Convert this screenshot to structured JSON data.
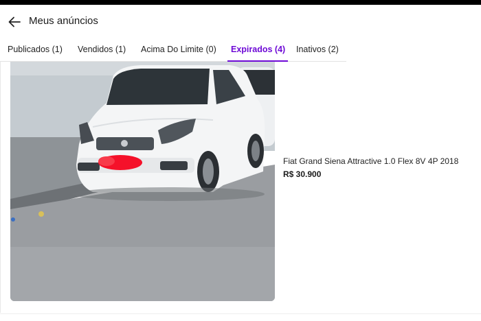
{
  "header": {
    "title": "Meus anúncios"
  },
  "tabs": [
    {
      "label": "Publicados (1)"
    },
    {
      "label": "Vendidos (1)"
    },
    {
      "label": "Acima Do Limite (0)"
    },
    {
      "label": "Expirados (4)"
    },
    {
      "label": "Inativos (2)"
    }
  ],
  "active_tab": "Expirados (4)",
  "listing": {
    "title": "Fiat Grand Siena Attractive 1.0 Flex 8V 4P 2018",
    "price": "R$ 30.900"
  },
  "colors": {
    "accent": "#6e0ad6",
    "text": "#1a1a1a"
  },
  "icons": {
    "back": "arrow-left-icon"
  }
}
